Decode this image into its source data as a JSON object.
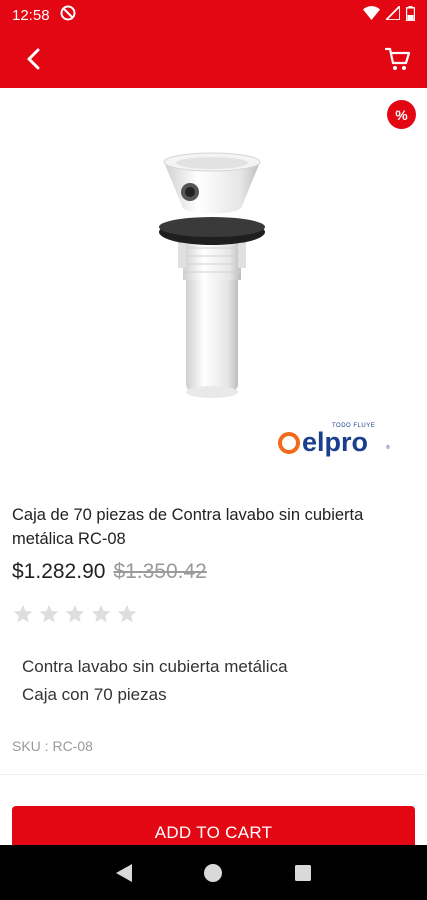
{
  "status_bar": {
    "time": "12:58"
  },
  "discount_badge": "%",
  "brand": {
    "text": "elpro",
    "tagline": "TODO FLUYE"
  },
  "product": {
    "title": "Caja de 70 piezas de Contra lavabo sin cubierta metálica RC-08",
    "price": "$1.282.90",
    "old_price": "$1.350.42",
    "rating": 0,
    "rating_max": 5,
    "description_lines": [
      "Contra lavabo sin cubierta metálica",
      "Caja con 70 piezas"
    ],
    "sku": "SKU : RC-08"
  },
  "actions": {
    "add_to_cart": "ADD TO CART"
  },
  "colors": {
    "brand_red": "#e30613",
    "logo_blue": "#1b3f8f",
    "logo_orange": "#f26a1b"
  }
}
